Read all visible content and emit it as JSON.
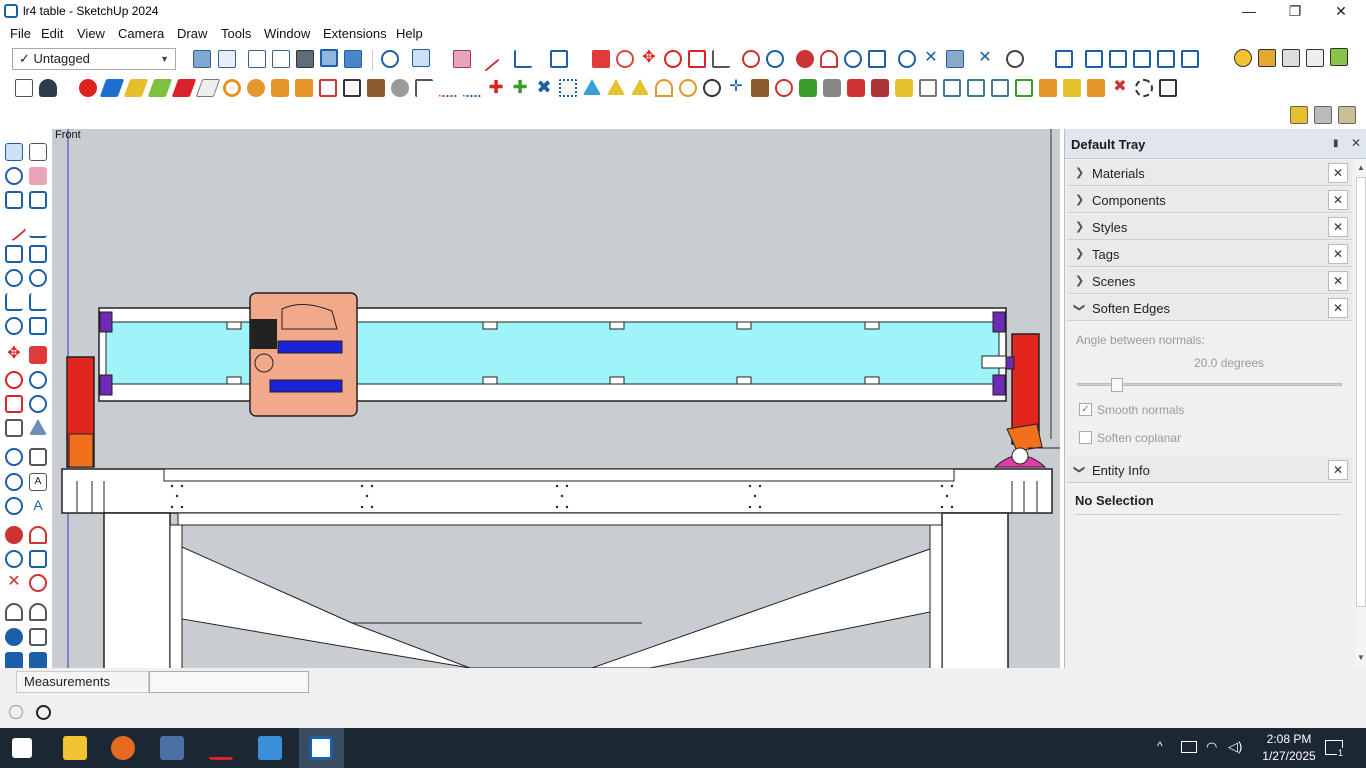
{
  "window": {
    "title": "lr4 table - SketchUp 2024",
    "minimize": "—",
    "maximize": "❐",
    "close": "✕"
  },
  "menu": [
    "File",
    "Edit",
    "View",
    "Camera",
    "Draw",
    "Tools",
    "Window",
    "Extensions",
    "Help"
  ],
  "toolbar": {
    "tag_selector": "Untagged",
    "tag_check": "✓"
  },
  "viewport": {
    "view_label": "Front"
  },
  "tray": {
    "title": "Default Tray",
    "panels": [
      {
        "name": "Materials",
        "expanded": false
      },
      {
        "name": "Components",
        "expanded": false
      },
      {
        "name": "Styles",
        "expanded": false
      },
      {
        "name": "Tags",
        "expanded": false
      },
      {
        "name": "Scenes",
        "expanded": false
      },
      {
        "name": "Soften Edges",
        "expanded": true
      },
      {
        "name": "Entity Info",
        "expanded": true
      }
    ],
    "soften": {
      "angle_label": "Angle between normals:",
      "angle_value": "20.0  degrees",
      "angle_slider_fraction": 0.13,
      "smooth_normals": "Smooth normals",
      "smooth_checked": true,
      "soften_coplanar": "Soften coplanar",
      "coplanar_checked": false
    },
    "entity_info": {
      "status": "No Selection"
    }
  },
  "status": {
    "measurements_label": "Measurements",
    "measurements_value": ""
  },
  "taskbar": {
    "time": "2:08 PM",
    "date": "1/27/2025",
    "notif_count": "1"
  },
  "colors": {
    "accent": "#1d5ea8",
    "cyan_panel": "#9ef4f8",
    "carriage": "#f2a98b",
    "red_motor": "#e2261d",
    "purple_block": "#6d2bb5",
    "blue_belt": "#1c22d8",
    "magenta_part": "#e23aa8"
  }
}
